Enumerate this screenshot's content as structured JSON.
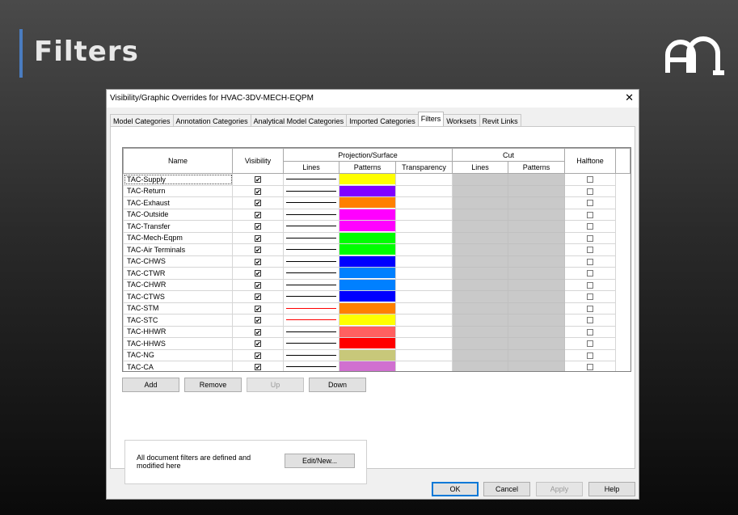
{
  "slide": {
    "title": "Filters"
  },
  "dialog": {
    "title": "Visibility/Graphic Overrides for HVAC-3DV-MECH-EQPM",
    "close_glyph": "✕",
    "tabs": [
      "Model Categories",
      "Annotation Categories",
      "Analytical Model Categories",
      "Imported Categories",
      "Filters",
      "Worksets",
      "Revit Links"
    ],
    "active_tab": "Filters",
    "headers": {
      "name": "Name",
      "visibility": "Visibility",
      "projection_surface": "Projection/Surface",
      "cut": "Cut",
      "halftone": "Halftone",
      "lines": "Lines",
      "patterns": "Patterns",
      "transparency": "Transparency",
      "cut_lines": "Lines",
      "cut_patterns": "Patterns"
    },
    "check_glyph": "✔",
    "rows": [
      {
        "name": "TAC-Supply",
        "visible": true,
        "line_color": "#000000",
        "pattern_color": "#ffff00",
        "halftone": false
      },
      {
        "name": "TAC-Return",
        "visible": true,
        "line_color": "#000000",
        "pattern_color": "#8000ff",
        "halftone": false
      },
      {
        "name": "TAC-Exhaust",
        "visible": true,
        "line_color": "#000000",
        "pattern_color": "#ff8000",
        "halftone": false
      },
      {
        "name": "TAC-Outside",
        "visible": true,
        "line_color": "#000000",
        "pattern_color": "#ff00ff",
        "halftone": false
      },
      {
        "name": "TAC-Transfer",
        "visible": true,
        "line_color": "#000000",
        "pattern_color": "#ff00ff",
        "halftone": false
      },
      {
        "name": "TAC-Mech-Eqpm",
        "visible": true,
        "line_color": "#000000",
        "pattern_color": "#00ff00",
        "halftone": false
      },
      {
        "name": "TAC-Air Terminals",
        "visible": true,
        "line_color": "#000000",
        "pattern_color": "#00ff00",
        "halftone": false
      },
      {
        "name": "TAC-CHWS",
        "visible": true,
        "line_color": "#000000",
        "pattern_color": "#0000ff",
        "halftone": false
      },
      {
        "name": "TAC-CTWR",
        "visible": true,
        "line_color": "#000000",
        "pattern_color": "#0080ff",
        "halftone": false
      },
      {
        "name": "TAC-CHWR",
        "visible": true,
        "line_color": "#000000",
        "pattern_color": "#0080ff",
        "halftone": false
      },
      {
        "name": "TAC-CTWS",
        "visible": true,
        "line_color": "#000000",
        "pattern_color": "#0000ff",
        "halftone": false
      },
      {
        "name": "TAC-STM",
        "visible": true,
        "line_color": "#ff0000",
        "pattern_color": "#ff8000",
        "halftone": false
      },
      {
        "name": "TAC-STC",
        "visible": true,
        "line_color": "#ff0000",
        "pattern_color": "#ffff00",
        "halftone": false
      },
      {
        "name": "TAC-HHWR",
        "visible": true,
        "line_color": "#000000",
        "pattern_color": "#ff6060",
        "halftone": false
      },
      {
        "name": "TAC-HHWS",
        "visible": true,
        "line_color": "#000000",
        "pattern_color": "#ff0000",
        "halftone": false
      },
      {
        "name": "TAC-NG",
        "visible": true,
        "line_color": "#000000",
        "pattern_color": "#c8c87a",
        "halftone": false
      },
      {
        "name": "TAC-CA",
        "visible": true,
        "line_color": "#000000",
        "pattern_color": "#d070d0",
        "halftone": false
      }
    ],
    "buttons": {
      "add": "Add",
      "remove": "Remove",
      "up": "Up",
      "down": "Down"
    },
    "info": {
      "message": "All document filters are defined and modified here",
      "edit_new": "Edit/New..."
    },
    "footer": {
      "ok": "OK",
      "cancel": "Cancel",
      "apply": "Apply",
      "help": "Help"
    }
  }
}
